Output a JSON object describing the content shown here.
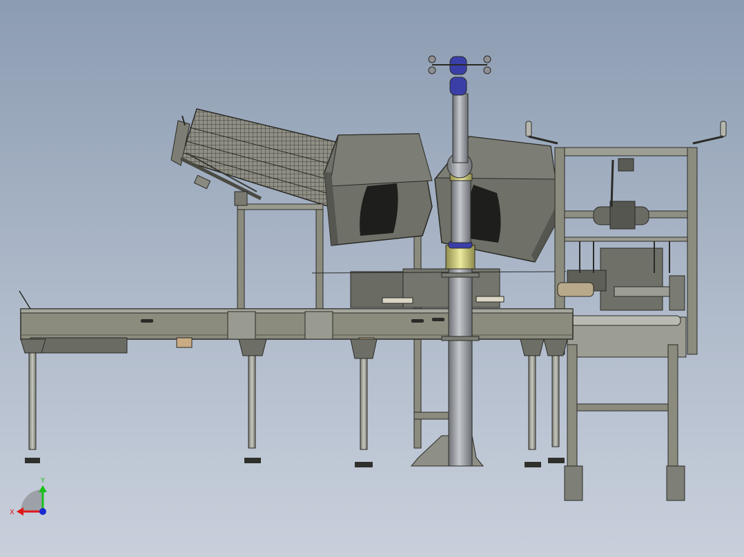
{
  "axis_triad": {
    "x_label": "X",
    "y_label": "Y",
    "x_color": "#e01818",
    "y_color": "#18c018",
    "z_color": "#1a2ad0"
  },
  "colors": {
    "background_top": "#8c9cb2",
    "background_bottom": "#c9d0dc",
    "frame": "#8b8b7e",
    "frame_dark": "#5e5e55",
    "steel": "#a3a49b",
    "housing": "#6f7068",
    "housing_dark": "#4b4c45",
    "window": "#1e1f1c",
    "column": "#9b9ea2",
    "accent_yellow": "#d8d48a",
    "accent_blue": "#3a3fa8",
    "wood": "#c9ab84",
    "outline": "#2a2a26"
  }
}
